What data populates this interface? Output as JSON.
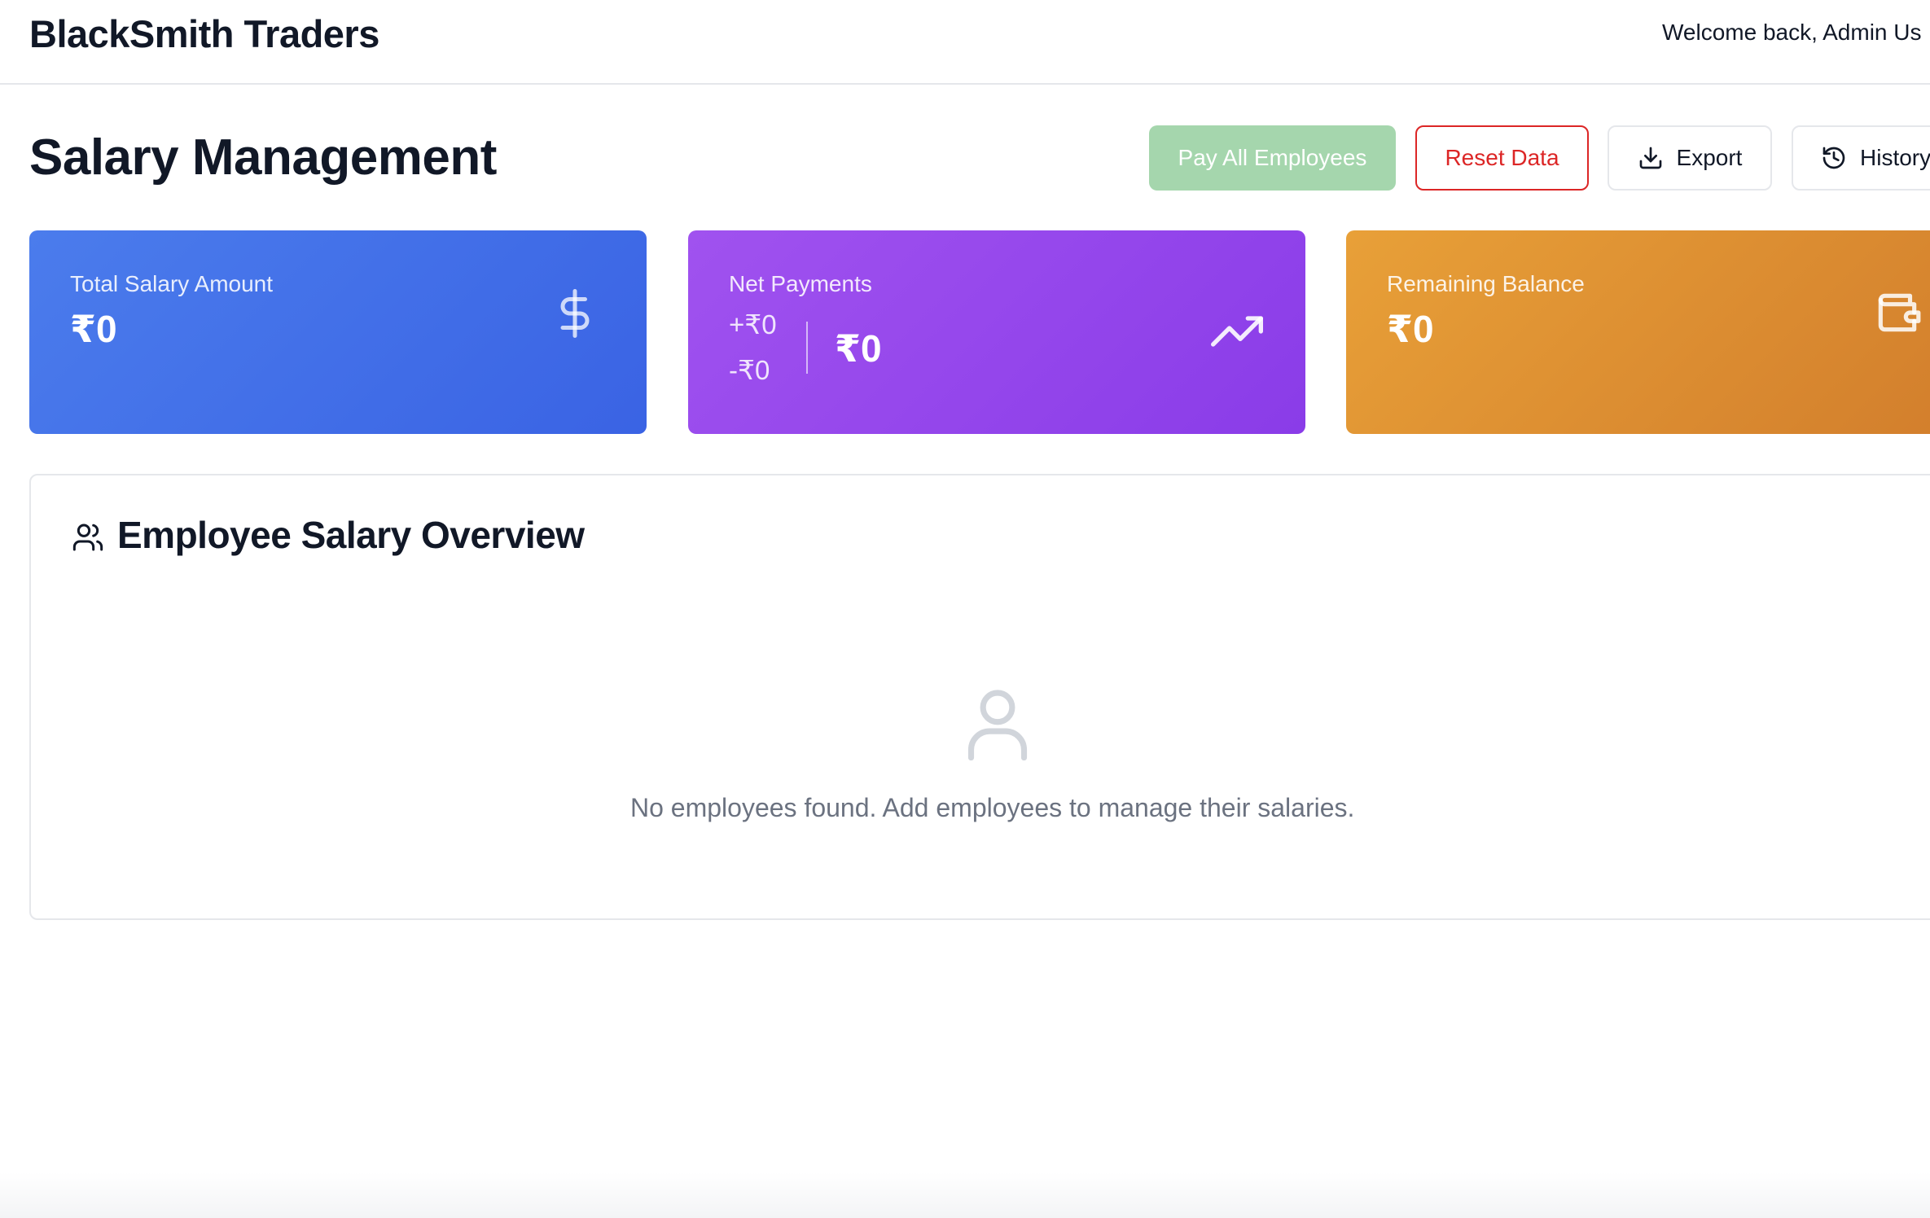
{
  "header": {
    "brand": "BlackSmith Traders",
    "welcome": "Welcome back, Admin Us"
  },
  "page": {
    "title": "Salary Management"
  },
  "actions": {
    "pay_all": "Pay All Employees",
    "reset": "Reset Data",
    "export": "Export",
    "history": "History"
  },
  "stats": {
    "total_salary": {
      "label": "Total Salary Amount",
      "value": "₹0",
      "icon": "dollar-icon",
      "color": "#4470ea"
    },
    "net_payments": {
      "label": "Net Payments",
      "plus": "+₹0",
      "minus": "-₹0",
      "total": "₹0",
      "icon": "trending-up-icon",
      "color": "#9347eb"
    },
    "remaining_balance": {
      "label": "Remaining Balance",
      "value": "₹0",
      "icon": "wallet-icon",
      "color": "#de8f32"
    }
  },
  "overview": {
    "title": "Employee Salary Overview",
    "icon": "users-icon",
    "empty_icon": "user-icon",
    "empty_message": "No employees found. Add employees to manage their salaries."
  },
  "colors": {
    "pay_button": "#a5d6ad",
    "reset_button": "#dc2626",
    "muted_text": "#6b7280"
  }
}
